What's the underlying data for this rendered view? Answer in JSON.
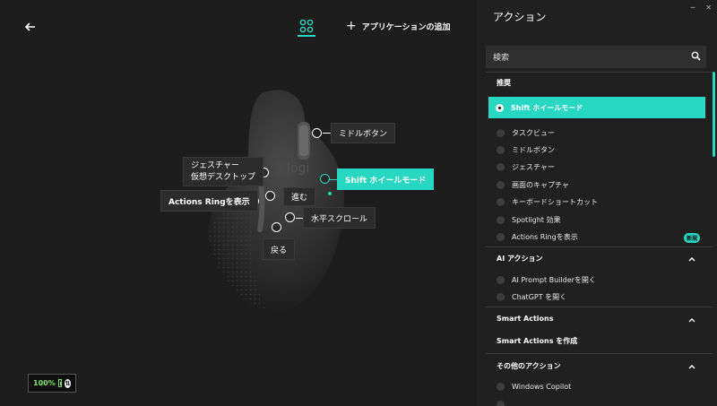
{
  "header": {
    "add_app_label": "アプリケーションの追加"
  },
  "device": {
    "battery": "100%"
  },
  "callouts": {
    "middle": "ミドルボタン",
    "gesture_line1": "ジェスチャー",
    "gesture_line2": "仮想デスクトップ",
    "shift": "Shift ホイールモード",
    "forward": "進む",
    "actions_ring": "Actions Ringを表示",
    "hscroll": "水平スクロール",
    "back": "戻る"
  },
  "panel": {
    "title": "アクション",
    "search_placeholder": "検索",
    "recommended": {
      "heading": "推奨",
      "items": [
        "Shift ホイールモード",
        "タスクビュー",
        "ミドルボタン",
        "ジェスチャー",
        "画面のキャプチャ",
        "キーボードショートカット",
        "Spotlight 効果",
        "Actions Ringを表示"
      ],
      "badge": "新規"
    },
    "ai": {
      "heading": "AI アクション",
      "items": [
        "AI Prompt Builderを開く",
        "ChatGPT を開く"
      ]
    },
    "smart": {
      "heading": "Smart Actions",
      "create": "Smart Actions を作成"
    },
    "other": {
      "heading": "その他のアクション",
      "items": [
        "Windows Copilot"
      ]
    }
  },
  "colors": {
    "accent": "#27d7c2",
    "background": "#1d1d1d"
  }
}
